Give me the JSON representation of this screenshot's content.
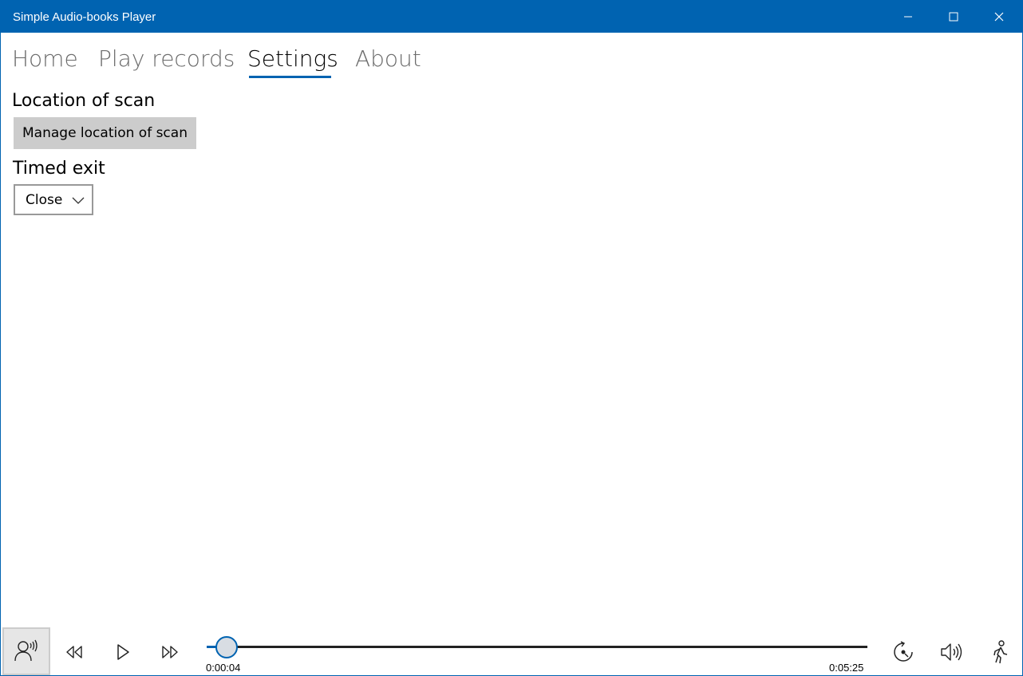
{
  "window": {
    "title": "Simple Audio-books Player",
    "accent_color": "#0063b1"
  },
  "tabs": [
    {
      "label": "Home",
      "active": false
    },
    {
      "label": "Play records",
      "active": false
    },
    {
      "label": "Settings",
      "active": true
    },
    {
      "label": "About",
      "active": false
    }
  ],
  "settings": {
    "location_label": "Location of scan",
    "manage_button": "Manage location of scan",
    "timed_exit_label": "Timed exit",
    "timed_exit_value": "Close"
  },
  "player": {
    "current_time": "0:00:04",
    "total_time": "0:05:25",
    "progress_fraction": 0.0123,
    "icons": [
      "speak-icon",
      "rewind-icon",
      "play-icon",
      "fast-forward-icon",
      "repeat-icon",
      "volume-icon",
      "walk-icon"
    ]
  }
}
